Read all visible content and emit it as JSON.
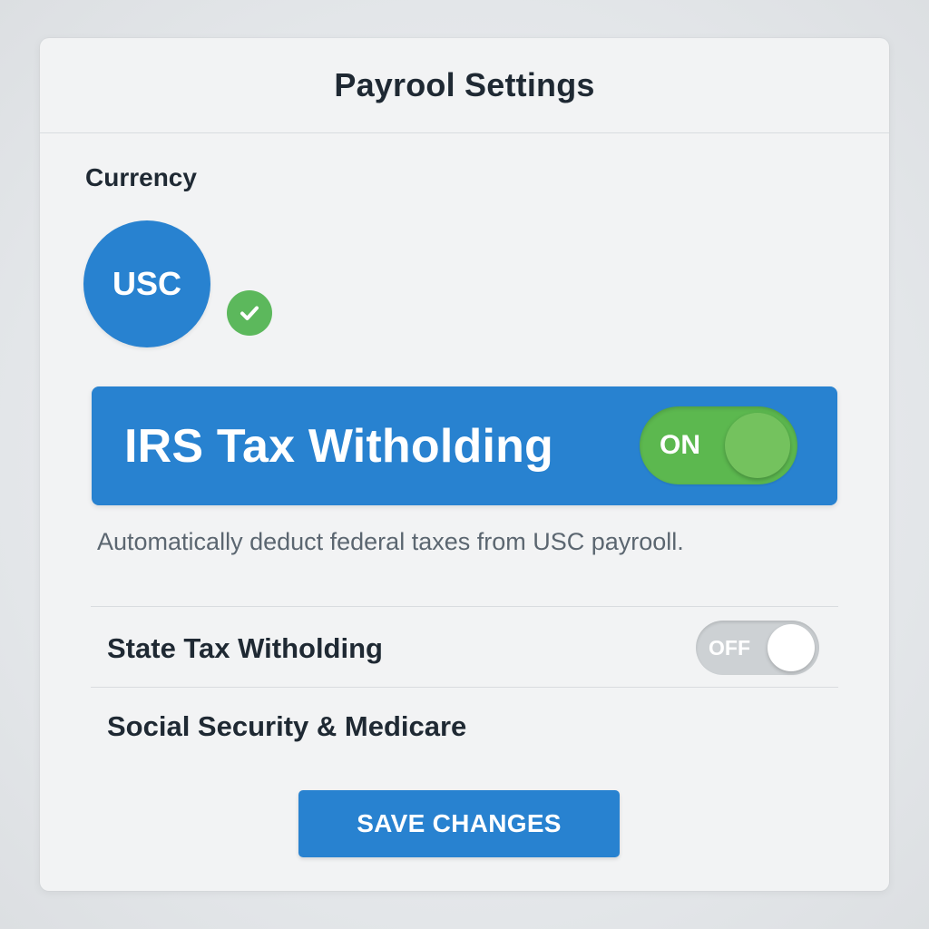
{
  "header": {
    "title": "Payrool Settings"
  },
  "currency": {
    "label": "Currency",
    "selected": "USC",
    "status_icon": "check-icon",
    "badge_color": "#2882d0",
    "check_color": "#5cb85c"
  },
  "irs": {
    "title": "IRS Tax Witholding",
    "toggle_label": "ON",
    "toggle_state": true,
    "description": "Automatically deduct federal taxes from USC payrooll.",
    "banner_color": "#2882d0",
    "toggle_color": "#5cb84f"
  },
  "state_tax": {
    "label": "State Tax Witholding",
    "toggle_label": "OFF",
    "toggle_state": false
  },
  "social_security": {
    "label": "Social Security & Medicare"
  },
  "actions": {
    "save_label": "SAVE CHANGES",
    "save_color": "#2882d0"
  }
}
